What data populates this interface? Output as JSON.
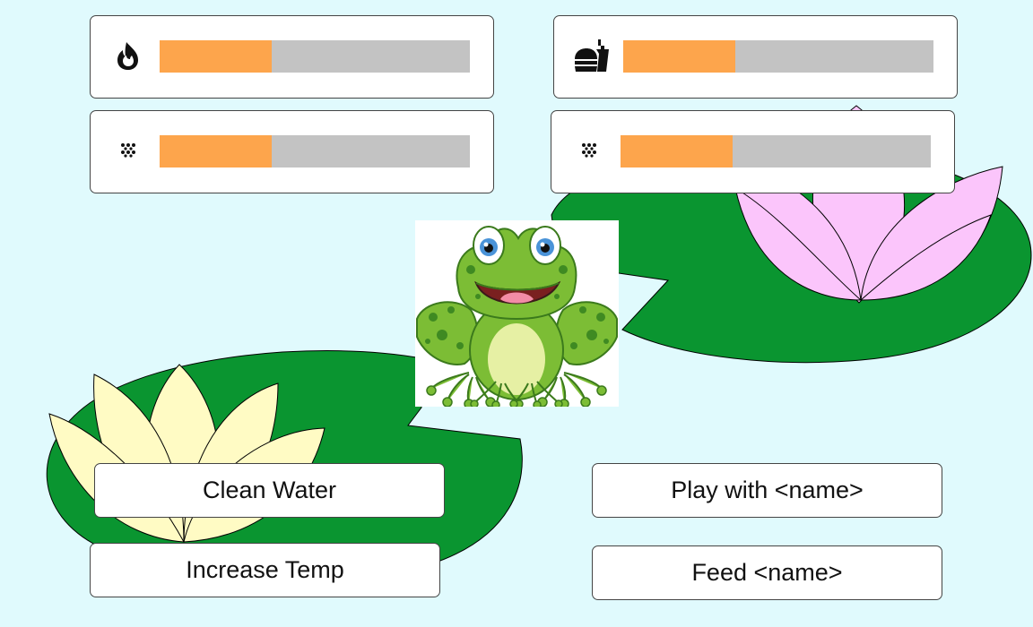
{
  "colors": {
    "background": "#e0fafd",
    "lily_pad": "#0a9530",
    "lotus_pink": "#fbc5fb",
    "lotus_cream": "#fffbc4",
    "bar_fill": "#fda54c",
    "bar_track": "#c3c3c3"
  },
  "stats": [
    {
      "icon": "flame-icon",
      "level": 0.36
    },
    {
      "icon": "fast-food-icon",
      "level": 0.36
    },
    {
      "icon": "dots-pattern-icon",
      "level": 0.36
    },
    {
      "icon": "dots-pattern-icon",
      "level": 0.36
    }
  ],
  "buttons": {
    "clean_water": "Clean Water",
    "play_with": "Play with <name>",
    "increase_temp": "Increase Temp",
    "feed": "Feed <name>"
  },
  "pet": {
    "species": "frog"
  }
}
